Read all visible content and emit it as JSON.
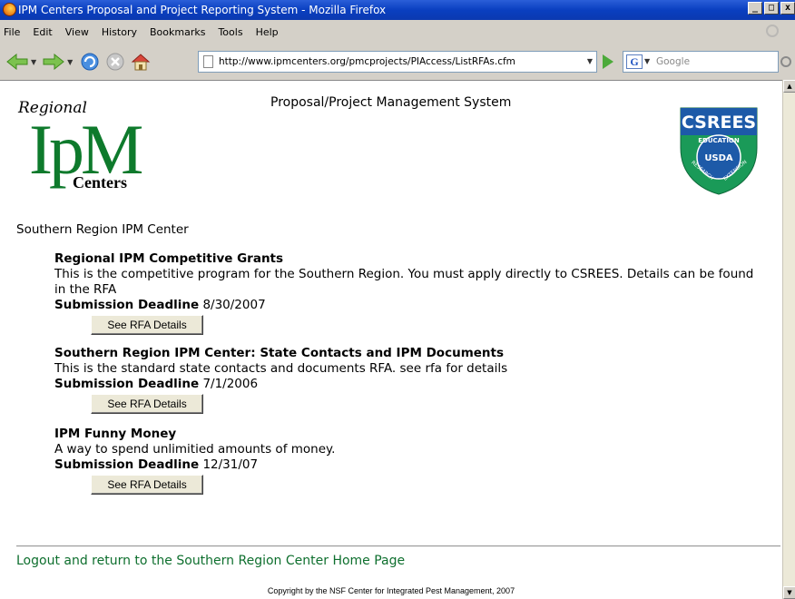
{
  "window": {
    "title": "IPM Centers Proposal and Project Reporting System - Mozilla Firefox",
    "controls": [
      "_",
      "□",
      "x"
    ]
  },
  "menu": [
    "File",
    "Edit",
    "View",
    "History",
    "Bookmarks",
    "Tools",
    "Help"
  ],
  "toolbar": {
    "url": "http://www.ipmcenters.org/pmcprojects/PIAccess/ListRFAs.cfm",
    "search_placeholder": "Google",
    "search_engine_letter": "G"
  },
  "page": {
    "logo": {
      "regional": "Regional",
      "ipm": "IpM",
      "centers": "Centers"
    },
    "system_title": "Proposal/Project Management System",
    "csrees_logo": {
      "top": "CSREES",
      "ring_top": "EDUCATION",
      "center": "USDA",
      "ring_left": "RESEARCH",
      "ring_right": "EXTENSION"
    },
    "region_title": "Southern Region IPM Center",
    "deadline_label": "Submission Deadline",
    "button_label": "See RFA Details",
    "rfas": [
      {
        "title": "Regional IPM Competitive Grants",
        "description": "This is the competitive program for the Southern Region. You must apply directly to CSREES. Details can be found in the RFA",
        "deadline": "8/30/2007"
      },
      {
        "title": "Southern Region IPM Center: State Contacts and IPM Documents",
        "description": "This is the standard state contacts and documents RFA. see rfa for details",
        "deadline": "7/1/2006"
      },
      {
        "title": "IPM Funny Money",
        "description": "A way to spend unlimitied amounts of money.",
        "deadline": "12/31/07"
      }
    ],
    "logout_link": "Logout and return to the Southern Region Center Home Page",
    "copyright": "Copyright by the NSF Center for Integrated Pest Management, 2007"
  }
}
